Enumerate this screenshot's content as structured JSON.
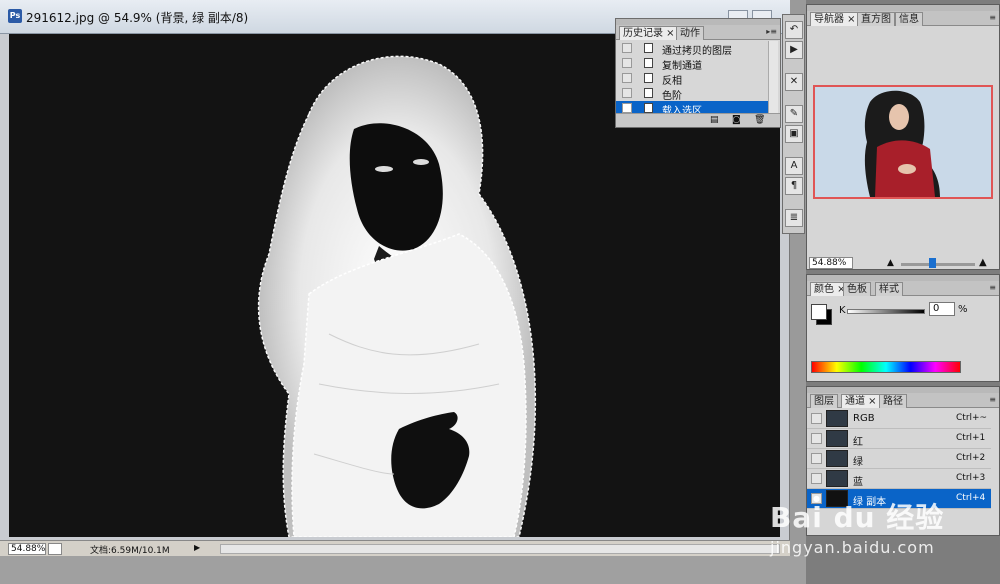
{
  "document": {
    "title": "291612.jpg @ 54.9% (背景, 绿 副本/8)",
    "app_icon": "Ps"
  },
  "status": {
    "zoom": "54.88%",
    "doc_info": "文档:6.59M/10.1M"
  },
  "history_panel": {
    "tabs": [
      {
        "label": "历史记录 ×"
      },
      {
        "label": "动作"
      }
    ],
    "items": [
      {
        "label": "通过拷贝的图层"
      },
      {
        "label": "复制通道"
      },
      {
        "label": "反相"
      },
      {
        "label": "色阶"
      },
      {
        "label": "载入选区",
        "selected": true
      }
    ]
  },
  "navigator_panel": {
    "tabs": [
      {
        "label": "导航器 ×"
      },
      {
        "label": "直方图"
      },
      {
        "label": "信息"
      }
    ],
    "zoom": "54.88%"
  },
  "color_panel": {
    "tabs": [
      {
        "label": "颜色 ×"
      },
      {
        "label": "色板"
      },
      {
        "label": "样式"
      }
    ],
    "k_label": "K",
    "k_value": "0",
    "k_unit": "%"
  },
  "channels_panel": {
    "tabs": [
      {
        "label": "图层"
      },
      {
        "label": "通道 ×"
      },
      {
        "label": "路径"
      }
    ],
    "channels": [
      {
        "name": "RGB",
        "shortcut": "Ctrl+~"
      },
      {
        "name": "红",
        "shortcut": "Ctrl+1"
      },
      {
        "name": "绿",
        "shortcut": "Ctrl+2"
      },
      {
        "name": "蓝",
        "shortcut": "Ctrl+3"
      },
      {
        "name": "绿 副本",
        "shortcut": "Ctrl+4",
        "selected": true
      }
    ]
  },
  "watermark": {
    "logo": "Bai du 经验",
    "url": "jingyan.baidu.com"
  },
  "icons": [
    "photoshop-icon",
    "history-icon",
    "actions-play-icon",
    "tools-icon",
    "brush-icon",
    "stamp-icon",
    "text-icon",
    "paragraph-icon",
    "layer-comps-icon",
    "eye-icon",
    "new-document-icon",
    "snapshot-icon",
    "trash-icon",
    "zoom-out-icon",
    "zoom-in-icon"
  ]
}
